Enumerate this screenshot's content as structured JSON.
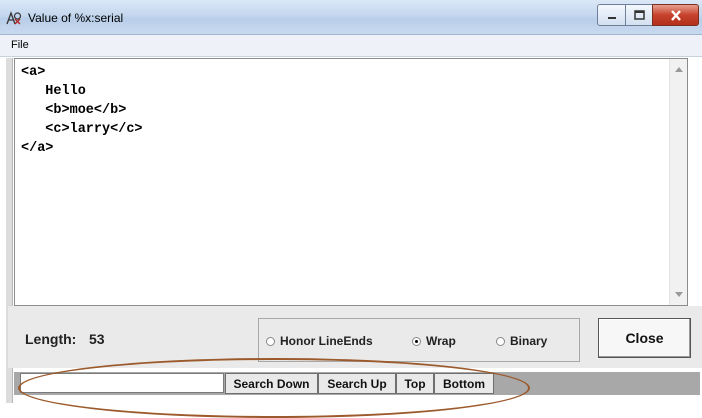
{
  "window": {
    "title": "Value of %x:serial",
    "controls": {
      "minimize": "minimize-icon",
      "maximize": "maximize-icon",
      "close": "close-icon"
    }
  },
  "menu": {
    "file": "File"
  },
  "editor": {
    "lines": [
      "<a>",
      "   Hello",
      "   <b>moe</b>",
      "   <c>larry</c>",
      "</a>"
    ]
  },
  "footer": {
    "length_label": "Length:",
    "length_value": "53",
    "options": [
      {
        "label": "Honor LineEnds",
        "selected": false
      },
      {
        "label": "Wrap",
        "selected": true
      },
      {
        "label": "Binary",
        "selected": false
      }
    ],
    "close_label": "Close"
  },
  "search": {
    "value": "",
    "buttons": [
      "Search Down",
      "Search Up",
      "Top",
      "Bottom"
    ]
  },
  "colors": {
    "annotation_ellipse": "#9c5a2c",
    "close_button_red": "#c6422c"
  }
}
